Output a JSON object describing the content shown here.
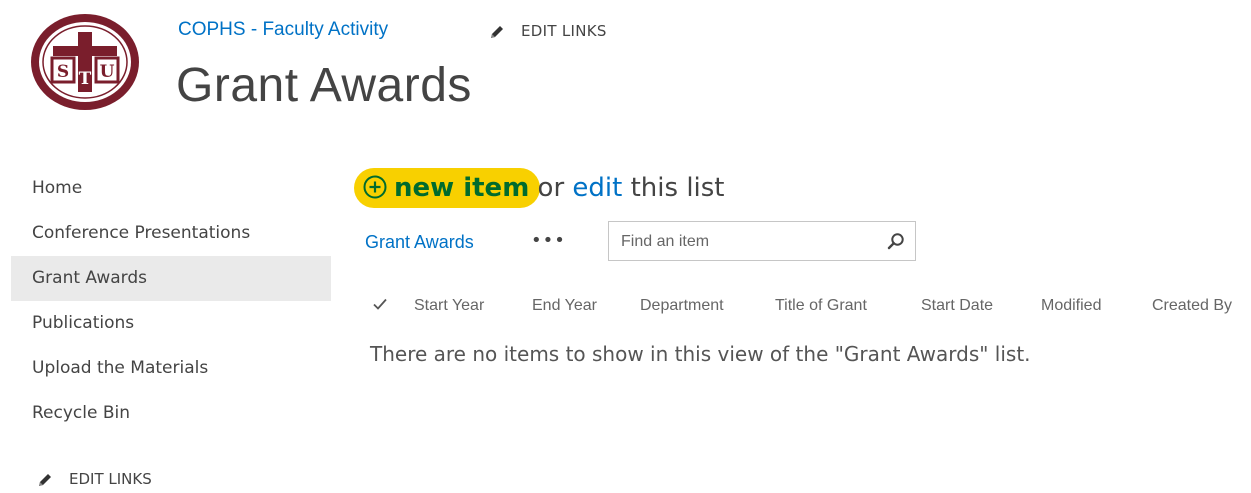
{
  "header": {
    "site_title": "COPHS - Faculty Activity",
    "edit_links": "EDIT LINKS",
    "page_title": "Grant Awards"
  },
  "logo": {
    "icon": "university-seal-logo",
    "letters": [
      "S",
      "T",
      "U"
    ],
    "color": "#7a1e2c"
  },
  "nav": {
    "items": [
      {
        "label": "Home"
      },
      {
        "label": "Conference Presentations"
      },
      {
        "label": "Grant Awards",
        "selected": true
      },
      {
        "label": "Publications"
      },
      {
        "label": "Upload the Materials"
      },
      {
        "label": "Recycle Bin"
      }
    ],
    "edit_links": "EDIT LINKS"
  },
  "actions": {
    "new_item": "new item",
    "or": "or",
    "edit": "edit",
    "this_list": "this list",
    "highlight_color": "#f8d000",
    "new_item_color": "#006b2d"
  },
  "view": {
    "name": "Grant Awards",
    "more": "•••",
    "search_placeholder": "Find an item"
  },
  "columns": [
    "Start Year",
    "End Year",
    "Department",
    "Title of Grant",
    "Start Date",
    "Modified",
    "Created By"
  ],
  "empty_message": "There are no items to show in this view of the \"Grant Awards\" list.",
  "colors": {
    "link_blue": "#0072c6",
    "text": "#444444",
    "selected_nav_bg": "#eaeaea"
  }
}
